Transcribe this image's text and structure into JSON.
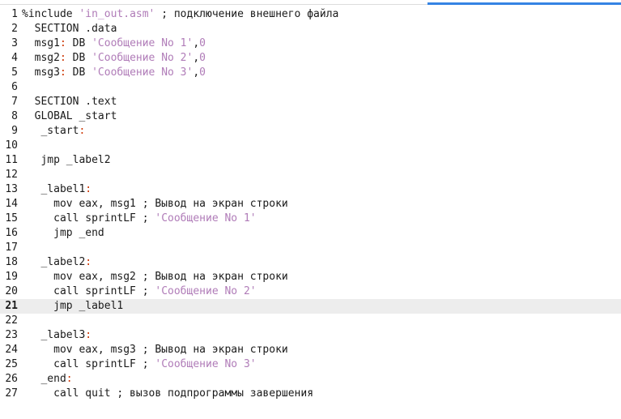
{
  "editor": {
    "lines": [
      {
        "num": "1",
        "tokens": [
          {
            "t": "pre",
            "v": "%include "
          },
          {
            "t": "str",
            "v": "'in_out.asm'"
          },
          {
            "t": "plain",
            "v": " ; подключение внешнего файла"
          }
        ]
      },
      {
        "num": "2",
        "tokens": [
          {
            "t": "plain",
            "v": "  SECTION .data"
          }
        ]
      },
      {
        "num": "3",
        "tokens": [
          {
            "t": "plain",
            "v": "  msg1"
          },
          {
            "t": "sym",
            "v": ":"
          },
          {
            "t": "plain",
            "v": " DB "
          },
          {
            "t": "str",
            "v": "'Сообщение No 1'"
          },
          {
            "t": "plain",
            "v": ","
          },
          {
            "t": "num",
            "v": "0"
          }
        ]
      },
      {
        "num": "4",
        "tokens": [
          {
            "t": "plain",
            "v": "  msg2"
          },
          {
            "t": "sym",
            "v": ":"
          },
          {
            "t": "plain",
            "v": " DB "
          },
          {
            "t": "str",
            "v": "'Сообщение No 2'"
          },
          {
            "t": "plain",
            "v": ","
          },
          {
            "t": "num",
            "v": "0"
          }
        ]
      },
      {
        "num": "5",
        "tokens": [
          {
            "t": "plain",
            "v": "  msg3"
          },
          {
            "t": "sym",
            "v": ":"
          },
          {
            "t": "plain",
            "v": " DB "
          },
          {
            "t": "str",
            "v": "'Сообщение No 3'"
          },
          {
            "t": "plain",
            "v": ","
          },
          {
            "t": "num",
            "v": "0"
          }
        ]
      },
      {
        "num": "6",
        "tokens": []
      },
      {
        "num": "7",
        "tokens": [
          {
            "t": "plain",
            "v": "  SECTION .text"
          }
        ]
      },
      {
        "num": "8",
        "tokens": [
          {
            "t": "plain",
            "v": "  GLOBAL _start"
          }
        ]
      },
      {
        "num": "9",
        "tokens": [
          {
            "t": "plain",
            "v": "   _start"
          },
          {
            "t": "sym",
            "v": ":"
          }
        ]
      },
      {
        "num": "10",
        "tokens": []
      },
      {
        "num": "11",
        "tokens": [
          {
            "t": "plain",
            "v": "   jmp _label2"
          }
        ]
      },
      {
        "num": "12",
        "tokens": []
      },
      {
        "num": "13",
        "tokens": [
          {
            "t": "plain",
            "v": "   _label1"
          },
          {
            "t": "sym",
            "v": ":"
          }
        ]
      },
      {
        "num": "14",
        "tokens": [
          {
            "t": "plain",
            "v": "     mov eax, msg1 ; Вывод на экран строки"
          }
        ]
      },
      {
        "num": "15",
        "tokens": [
          {
            "t": "plain",
            "v": "     call sprintLF ; "
          },
          {
            "t": "str",
            "v": "'Сообщение No 1'"
          }
        ]
      },
      {
        "num": "16",
        "tokens": [
          {
            "t": "plain",
            "v": "     jmp _end"
          }
        ]
      },
      {
        "num": "17",
        "tokens": []
      },
      {
        "num": "18",
        "tokens": [
          {
            "t": "plain",
            "v": "   _label2"
          },
          {
            "t": "sym",
            "v": ":"
          }
        ]
      },
      {
        "num": "19",
        "tokens": [
          {
            "t": "plain",
            "v": "     mov eax, msg2 ; Вывод на экран строки"
          }
        ]
      },
      {
        "num": "20",
        "tokens": [
          {
            "t": "plain",
            "v": "     call sprintLF ; "
          },
          {
            "t": "str",
            "v": "'Сообщение No 2'"
          }
        ]
      },
      {
        "num": "21",
        "current": true,
        "tokens": [
          {
            "t": "plain",
            "v": "     jmp _label1"
          }
        ]
      },
      {
        "num": "22",
        "tokens": []
      },
      {
        "num": "23",
        "tokens": [
          {
            "t": "plain",
            "v": "   _label3"
          },
          {
            "t": "sym",
            "v": ":"
          }
        ]
      },
      {
        "num": "24",
        "tokens": [
          {
            "t": "plain",
            "v": "     mov eax, msg3 ; Вывод на экран строки"
          }
        ]
      },
      {
        "num": "25",
        "tokens": [
          {
            "t": "plain",
            "v": "     call sprintLF ; "
          },
          {
            "t": "str",
            "v": "'Сообщение No 3'"
          }
        ]
      },
      {
        "num": "26",
        "tokens": [
          {
            "t": "plain",
            "v": "   _end"
          },
          {
            "t": "sym",
            "v": ":"
          }
        ]
      },
      {
        "num": "27",
        "tokens": [
          {
            "t": "plain",
            "v": "     call quit ; вызов подпрограммы завершения"
          }
        ]
      }
    ]
  },
  "colors": {
    "string": "#b07cb8",
    "symbol": "#cc3300",
    "current_line_bg": "#ededed",
    "accent": "#3584e4"
  }
}
